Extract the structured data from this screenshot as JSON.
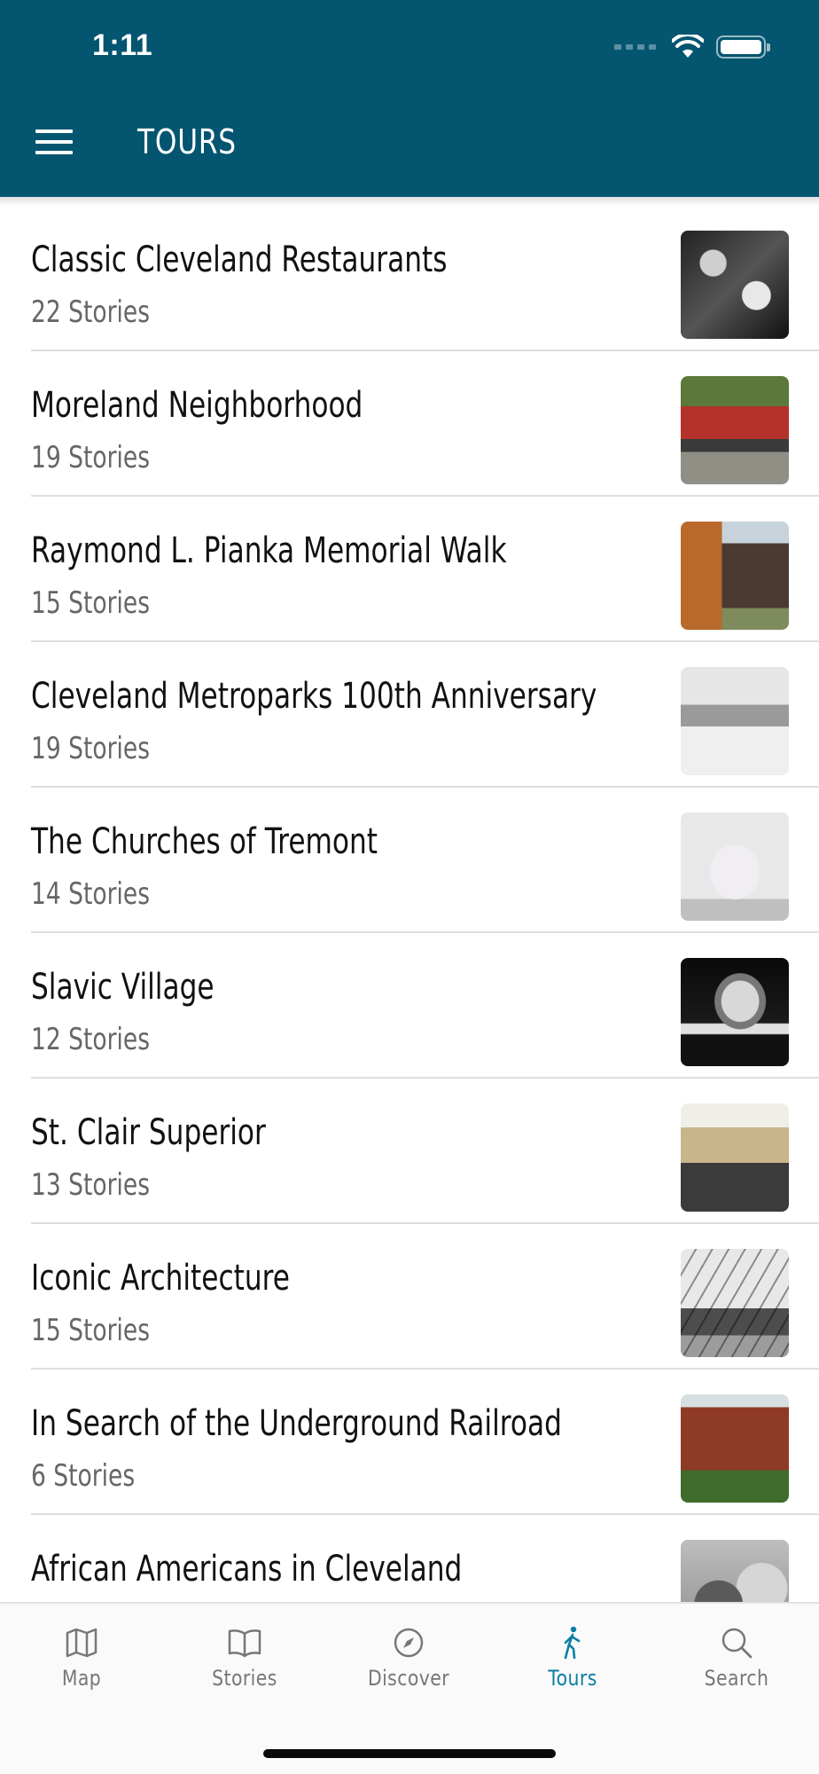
{
  "status_bar": {
    "time": "1:11"
  },
  "header": {
    "title": "TOURS"
  },
  "tours": [
    {
      "title": "Classic Cleveland Restaurants",
      "count": "22 Stories"
    },
    {
      "title": "Moreland Neighborhood",
      "count": "19 Stories"
    },
    {
      "title": "Raymond L. Pianka Memorial Walk",
      "count": "15 Stories"
    },
    {
      "title": "Cleveland Metroparks 100th Anniversary",
      "count": "19 Stories"
    },
    {
      "title": "The Churches of Tremont",
      "count": "14 Stories"
    },
    {
      "title": "Slavic Village",
      "count": "12 Stories"
    },
    {
      "title": "St. Clair Superior",
      "count": "13 Stories"
    },
    {
      "title": "Iconic Architecture",
      "count": "15 Stories"
    },
    {
      "title": "In Search of the Underground Railroad",
      "count": "6 Stories"
    },
    {
      "title": "African Americans in Cleveland",
      "count": ""
    }
  ],
  "tabbar": {
    "tabs": [
      {
        "label": "Map",
        "icon": "map-icon"
      },
      {
        "label": "Stories",
        "icon": "book-icon"
      },
      {
        "label": "Discover",
        "icon": "compass-icon"
      },
      {
        "label": "Tours",
        "icon": "walking-icon",
        "active": true
      },
      {
        "label": "Search",
        "icon": "search-icon"
      }
    ]
  },
  "colors": {
    "header": "#035570",
    "active_tab": "#0a7ea4",
    "inactive_tab": "#777777"
  }
}
